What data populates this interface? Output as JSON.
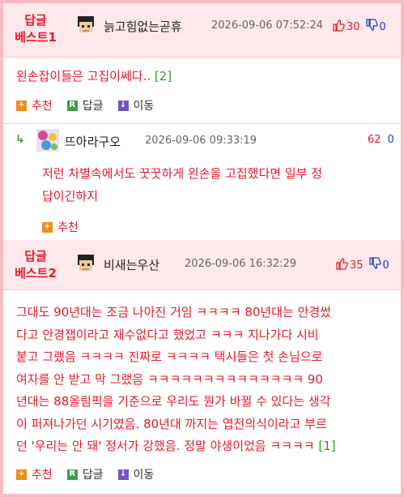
{
  "best1": {
    "label_line1": "답글",
    "label_line2": "베스트1",
    "nickname": "늙고힘없는곧휴",
    "date": "2026-09-06 07:52:24",
    "up_count": "30",
    "down_count": "0",
    "text": "왼손잡이들은 고집이쎄다..",
    "reply_count": "[2]",
    "actions": {
      "recommend": "추천",
      "reply": "답글",
      "move": "이동"
    }
  },
  "reply1": {
    "nickname": "뜨아라구오",
    "date": "2026-09-06 09:33:19",
    "up_count": "62",
    "down_count": "0",
    "text_line1": "저런 차별속에서도 꿋꿋하게 왼손을 고집했다면 일부 정",
    "text_line2": "답이긴하지",
    "actions": {
      "recommend": "추천"
    }
  },
  "best2": {
    "label_line1": "답글",
    "label_line2": "베스트2",
    "nickname": "비새는우산",
    "date": "2026-09-06 16:32:29",
    "up_count": "35",
    "down_count": "0",
    "lines": [
      "그대도 90년대는 조금 나아진 거임 ㅋㅋㅋㅋ 80년대는 안경썼",
      "다고 안경잽이라고 재수없다고 했었고 ㅋㅋㅋ 지나가다 시비",
      "붙고 그랬음 ㅋㅋㅋㅋ 진짜로 ㅋㅋㅋㅋ 택시들은 첫 손님으로",
      "여자를 안 받고 막 그랬음 ㅋㅋㅋㅋㅋㅋㅋㅋㅋㅋㅋㅋㅋㅋ 90",
      "년대는 88올림픽을 기준으로 우리도 뭔가 바뀔 수 있다는 생각",
      "이 퍼져나가던 시기였음. 80년대 까지는 엽전의식이라고 부르",
      "던 '우리는 안 돼' 정서가 강했음. 정말 야생이었음 ㅋㅋㅋㅋ"
    ],
    "reply_count": "[1]",
    "actions": {
      "recommend": "추천",
      "reply": "답글",
      "move": "이동"
    }
  },
  "icons": {
    "thumb_up": "thumbs-up-icon",
    "thumb_down": "thumbs-down-icon",
    "recommend_badge": "+",
    "reply_badge": "R",
    "move_badge": "↓",
    "reply_arrow": "↳"
  },
  "colors": {
    "accent_red": "#e8192c",
    "header_pink": "#fde9ec",
    "border_pink": "#f6bcc3",
    "reply_green": "#39a046",
    "down_blue": "#1a3fc4"
  }
}
